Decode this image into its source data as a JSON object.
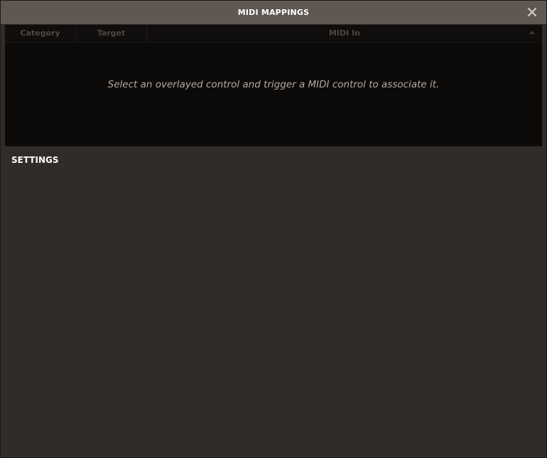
{
  "dialog": {
    "title": "MIDI MAPPINGS",
    "close_icon": "close-icon"
  },
  "table": {
    "columns": [
      "Category",
      "Target",
      "MIDI In"
    ],
    "sort_icon": "sort-ascending-icon",
    "empty_message": "Select an overlayed control and trigger a MIDI control to associate it."
  },
  "settings": {
    "title": "SETTINGS"
  },
  "colors": {
    "titlebar": "#5f5752",
    "table_bg": "#0b0a09",
    "panel_bg": "#322c29",
    "text_muted": "#b3aaa4"
  }
}
